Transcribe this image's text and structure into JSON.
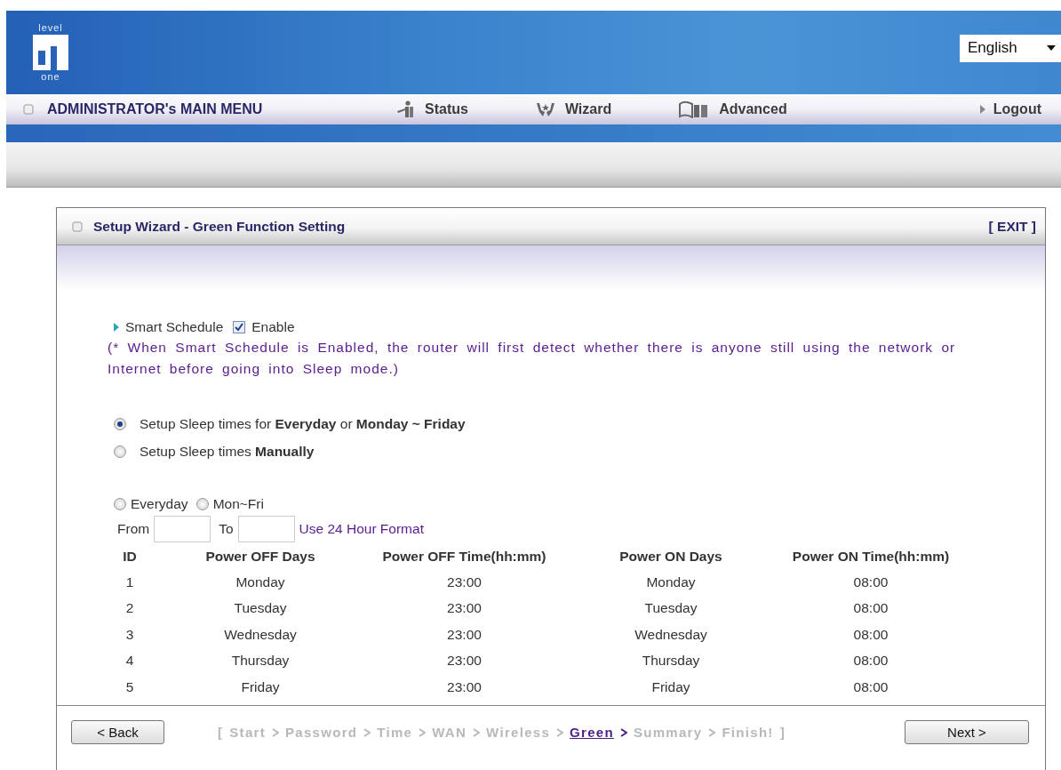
{
  "header": {
    "logo": {
      "top": "level",
      "bottom": "one"
    },
    "language": "English"
  },
  "menu": {
    "title": "ADMINISTRATOR's MAIN MENU",
    "items": [
      {
        "label": "Status",
        "kind": "status"
      },
      {
        "label": "Wizard",
        "kind": "wizard"
      },
      {
        "label": "Advanced",
        "kind": "advanced"
      },
      {
        "label": "Logout",
        "kind": "logout"
      }
    ]
  },
  "panel": {
    "title": "Setup Wizard - Green Function Setting",
    "exit": "[ EXIT ]",
    "smart_schedule": {
      "label": "Smart Schedule",
      "checked": true,
      "option": "Enable",
      "note": "(* When Smart Schedule is Enabled, the router will first detect whether there is anyone still using the network or Internet before going into Sleep mode.)"
    },
    "modes": [
      {
        "label": "Setup Sleep times for **Everyday** or **Monday ~ Friday**",
        "selected": true
      },
      {
        "label": "Setup Sleep times **Manually**",
        "selected": false
      }
    ],
    "day_options": [
      {
        "label": "Everyday",
        "selected": false
      },
      {
        "label": "Mon~Fri",
        "selected": false
      }
    ],
    "from_label": "From",
    "to_label": "To",
    "format_hint": "Use 24 Hour Format",
    "table": {
      "columns": [
        "ID",
        "Power OFF Days",
        "Power OFF Time(hh:mm)",
        "Power ON Days",
        "Power ON Time(hh:mm)"
      ],
      "rows": [
        [
          "1",
          "Monday",
          "23:00",
          "Monday",
          "08:00"
        ],
        [
          "2",
          "Tuesday",
          "23:00",
          "Tuesday",
          "08:00"
        ],
        [
          "3",
          "Wednesday",
          "23:00",
          "Wednesday",
          "08:00"
        ],
        [
          "4",
          "Thursday",
          "23:00",
          "Thursday",
          "08:00"
        ],
        [
          "5",
          "Friday",
          "23:00",
          "Friday",
          "08:00"
        ]
      ]
    },
    "back": "< Back",
    "next": "Next >",
    "steps": {
      "open": "[",
      "close": "]",
      "items": [
        {
          "label": "Start",
          "selected": false
        },
        {
          "label": "Password",
          "selected": false
        },
        {
          "label": "Time",
          "selected": false
        },
        {
          "label": "WAN",
          "selected": false
        },
        {
          "label": "Wireless",
          "selected": false
        },
        {
          "label": "Green",
          "selected": true
        },
        {
          "label": "Summary",
          "selected": false
        },
        {
          "label": "Finish!",
          "selected": false
        }
      ]
    }
  }
}
